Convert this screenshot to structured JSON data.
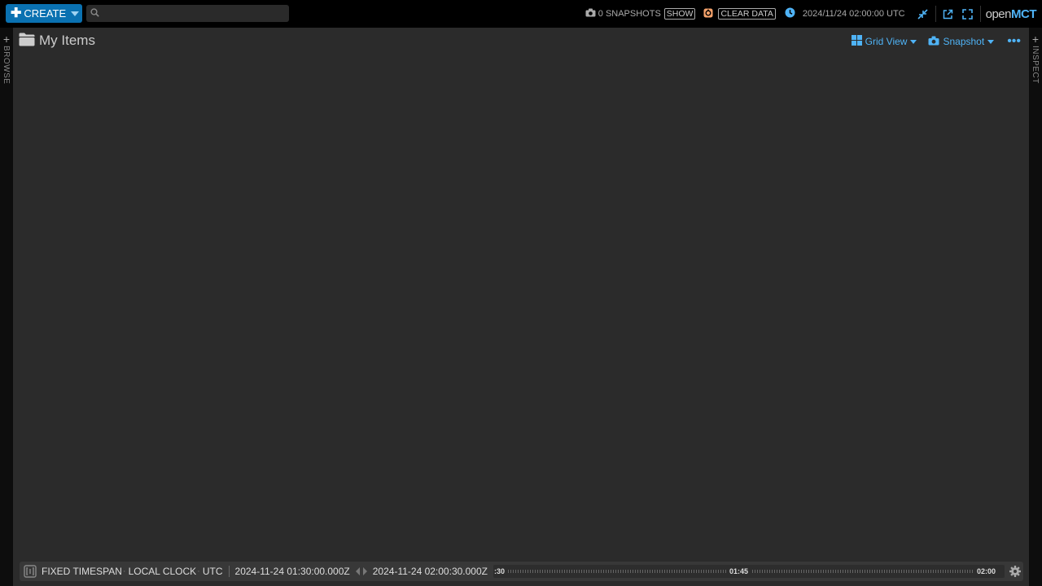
{
  "topbar": {
    "create_label": "CREATE",
    "search_placeholder": "",
    "snapshots_label": "0 SNAPSHOTS",
    "show_label": "SHOW",
    "clear_data_label": "CLEAR DATA",
    "clock_text": "2024/11/24 02:00:00 UTC",
    "logo_prefix": "open",
    "logo_suffix": "MCT"
  },
  "panes": {
    "browse_label": "BROWSE",
    "inspect_label": "INSPECT"
  },
  "object": {
    "title": "My Items",
    "view_label": "Grid View",
    "snapshot_label": "Snapshot"
  },
  "conductor": {
    "mode_label": "FIXED TIMESPAN",
    "clock_label": "LOCAL CLOCK",
    "timezone_label": "UTC",
    "start_time": "2024-11-24 01:30:00.000Z",
    "end_time": "2024-11-24 02:00:30.000Z",
    "tick_labels": [
      ":30",
      "01:45",
      "02:00"
    ]
  },
  "colors": {
    "accent": "#4fb3f6",
    "create_button": "#0a71b1",
    "clear_data_icon": "#f5a26b"
  }
}
